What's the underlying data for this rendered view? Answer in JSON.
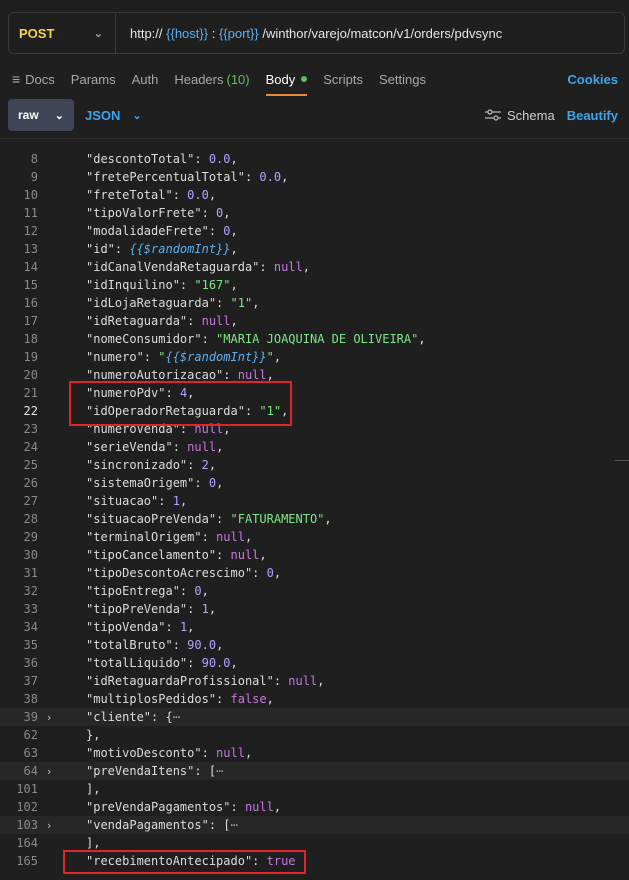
{
  "request": {
    "method": "POST",
    "url_parts": [
      {
        "text": "http:// ",
        "var": false
      },
      {
        "text": "{{host}}",
        "var": true
      },
      {
        "text": " : ",
        "var": false
      },
      {
        "text": "{{port}}",
        "var": true
      },
      {
        "text": " /winthor/varejo/matcon/v1/orders/pdvsync",
        "var": false
      }
    ]
  },
  "tabs": [
    {
      "label": "Docs",
      "icon": "docs-icon"
    },
    {
      "label": "Params"
    },
    {
      "label": "Auth"
    },
    {
      "label": "Headers",
      "count": "(10)"
    },
    {
      "label": "Body",
      "active": true
    },
    {
      "label": "Scripts"
    },
    {
      "label": "Settings"
    }
  ],
  "cookies_label": "Cookies",
  "body": {
    "mode": "raw",
    "format": "JSON",
    "schema_label": "Schema",
    "beautify_label": "Beautify"
  },
  "lines": [
    {
      "n": "8",
      "t": [
        [
          "k",
          "\"descontoTotal\""
        ],
        [
          "p",
          ": "
        ],
        [
          "n",
          "0.0"
        ],
        [
          "p",
          ","
        ]
      ]
    },
    {
      "n": "9",
      "t": [
        [
          "k",
          "\"fretePercentualTotal\""
        ],
        [
          "p",
          ": "
        ],
        [
          "n",
          "0.0"
        ],
        [
          "p",
          ","
        ]
      ]
    },
    {
      "n": "10",
      "t": [
        [
          "k",
          "\"freteTotal\""
        ],
        [
          "p",
          ": "
        ],
        [
          "n",
          "0.0"
        ],
        [
          "p",
          ","
        ]
      ]
    },
    {
      "n": "11",
      "t": [
        [
          "k",
          "\"tipoValorFrete\""
        ],
        [
          "p",
          ": "
        ],
        [
          "n",
          "0"
        ],
        [
          "p",
          ","
        ]
      ]
    },
    {
      "n": "12",
      "t": [
        [
          "k",
          "\"modalidadeFrete\""
        ],
        [
          "p",
          ": "
        ],
        [
          "n",
          "0"
        ],
        [
          "p",
          ","
        ]
      ]
    },
    {
      "n": "13",
      "t": [
        [
          "k",
          "\"id\""
        ],
        [
          "p",
          ": "
        ],
        [
          "v",
          "{{$randomInt}}"
        ],
        [
          "p",
          ","
        ]
      ]
    },
    {
      "n": "14",
      "t": [
        [
          "k",
          "\"idCanalVendaRetaguarda\""
        ],
        [
          "p",
          ": "
        ],
        [
          "kw",
          "null"
        ],
        [
          "p",
          ","
        ]
      ]
    },
    {
      "n": "15",
      "t": [
        [
          "k",
          "\"idInquilino\""
        ],
        [
          "p",
          ": "
        ],
        [
          "s",
          "\"167\""
        ],
        [
          "p",
          ","
        ]
      ]
    },
    {
      "n": "16",
      "t": [
        [
          "k",
          "\"idLojaRetaguarda\""
        ],
        [
          "p",
          ": "
        ],
        [
          "s",
          "\"1\""
        ],
        [
          "p",
          ","
        ]
      ]
    },
    {
      "n": "17",
      "t": [
        [
          "k",
          "\"idRetaguarda\""
        ],
        [
          "p",
          ": "
        ],
        [
          "kw",
          "null"
        ],
        [
          "p",
          ","
        ]
      ]
    },
    {
      "n": "18",
      "t": [
        [
          "k",
          "\"nomeConsumidor\""
        ],
        [
          "p",
          ": "
        ],
        [
          "s",
          "\"MARIA JOAQUINA DE OLIVEIRA\""
        ],
        [
          "p",
          ","
        ]
      ]
    },
    {
      "n": "19",
      "t": [
        [
          "k",
          "\"numero\""
        ],
        [
          "p",
          ": "
        ],
        [
          "s",
          "\""
        ],
        [
          "v",
          "{{$randomInt}}"
        ],
        [
          "s",
          "\""
        ],
        [
          "p",
          ","
        ]
      ]
    },
    {
      "n": "20",
      "t": [
        [
          "k",
          "\"numeroAutorizacao\""
        ],
        [
          "p",
          ": "
        ],
        [
          "kw",
          "null"
        ],
        [
          "p",
          ","
        ]
      ]
    },
    {
      "n": "21",
      "t": [
        [
          "k",
          "\"numeroPdv\""
        ],
        [
          "p",
          ": "
        ],
        [
          "n",
          "4"
        ],
        [
          "p",
          ","
        ]
      ]
    },
    {
      "n": "22",
      "cur": true,
      "t": [
        [
          "k",
          "\"idOperadorRetaguarda\""
        ],
        [
          "p",
          ": "
        ],
        [
          "s",
          "\"1\""
        ],
        [
          "p",
          ","
        ]
      ]
    },
    {
      "n": "23",
      "t": [
        [
          "k",
          "\"numeroVenda\""
        ],
        [
          "p",
          ": "
        ],
        [
          "kw",
          "null"
        ],
        [
          "p",
          ","
        ]
      ]
    },
    {
      "n": "24",
      "t": [
        [
          "k",
          "\"serieVenda\""
        ],
        [
          "p",
          ": "
        ],
        [
          "kw",
          "null"
        ],
        [
          "p",
          ","
        ]
      ]
    },
    {
      "n": "25",
      "t": [
        [
          "k",
          "\"sincronizado\""
        ],
        [
          "p",
          ": "
        ],
        [
          "n",
          "2"
        ],
        [
          "p",
          ","
        ]
      ]
    },
    {
      "n": "26",
      "t": [
        [
          "k",
          "\"sistemaOrigem\""
        ],
        [
          "p",
          ": "
        ],
        [
          "n",
          "0"
        ],
        [
          "p",
          ","
        ]
      ]
    },
    {
      "n": "27",
      "t": [
        [
          "k",
          "\"situacao\""
        ],
        [
          "p",
          ": "
        ],
        [
          "n",
          "1"
        ],
        [
          "p",
          ","
        ]
      ]
    },
    {
      "n": "28",
      "t": [
        [
          "k",
          "\"situacaoPreVenda\""
        ],
        [
          "p",
          ": "
        ],
        [
          "s",
          "\"FATURAMENTO\""
        ],
        [
          "p",
          ","
        ]
      ]
    },
    {
      "n": "29",
      "t": [
        [
          "k",
          "\"terminalOrigem\""
        ],
        [
          "p",
          ": "
        ],
        [
          "kw",
          "null"
        ],
        [
          "p",
          ","
        ]
      ]
    },
    {
      "n": "30",
      "t": [
        [
          "k",
          "\"tipoCancelamento\""
        ],
        [
          "p",
          ": "
        ],
        [
          "kw",
          "null"
        ],
        [
          "p",
          ","
        ]
      ]
    },
    {
      "n": "31",
      "t": [
        [
          "k",
          "\"tipoDescontoAcrescimo\""
        ],
        [
          "p",
          ": "
        ],
        [
          "n",
          "0"
        ],
        [
          "p",
          ","
        ]
      ]
    },
    {
      "n": "32",
      "t": [
        [
          "k",
          "\"tipoEntrega\""
        ],
        [
          "p",
          ": "
        ],
        [
          "n",
          "0"
        ],
        [
          "p",
          ","
        ]
      ]
    },
    {
      "n": "33",
      "t": [
        [
          "k",
          "\"tipoPreVenda\""
        ],
        [
          "p",
          ": "
        ],
        [
          "n",
          "1"
        ],
        [
          "p",
          ","
        ]
      ]
    },
    {
      "n": "34",
      "t": [
        [
          "k",
          "\"tipoVenda\""
        ],
        [
          "p",
          ": "
        ],
        [
          "n",
          "1"
        ],
        [
          "p",
          ","
        ]
      ]
    },
    {
      "n": "35",
      "t": [
        [
          "k",
          "\"totalBruto\""
        ],
        [
          "p",
          ": "
        ],
        [
          "n",
          "90.0"
        ],
        [
          "p",
          ","
        ]
      ]
    },
    {
      "n": "36",
      "t": [
        [
          "k",
          "\"totalLiquido\""
        ],
        [
          "p",
          ": "
        ],
        [
          "n",
          "90.0"
        ],
        [
          "p",
          ","
        ]
      ]
    },
    {
      "n": "37",
      "t": [
        [
          "k",
          "\"idRetaguardaProfissional\""
        ],
        [
          "p",
          ": "
        ],
        [
          "kw",
          "null"
        ],
        [
          "p",
          ","
        ]
      ]
    },
    {
      "n": "38",
      "t": [
        [
          "k",
          "\"multiplosPedidos\""
        ],
        [
          "p",
          ": "
        ],
        [
          "kw",
          "false"
        ],
        [
          "p",
          ","
        ]
      ]
    },
    {
      "n": "39",
      "fold": true,
      "hl": true,
      "t": [
        [
          "k",
          "\"cliente\""
        ],
        [
          "p",
          ": {"
        ],
        [
          "ell",
          "⋯"
        ]
      ]
    },
    {
      "n": "62",
      "t": [
        [
          "p",
          "},"
        ]
      ]
    },
    {
      "n": "63",
      "t": [
        [
          "k",
          "\"motivoDesconto\""
        ],
        [
          "p",
          ": "
        ],
        [
          "kw",
          "null"
        ],
        [
          "p",
          ","
        ]
      ]
    },
    {
      "n": "64",
      "fold": true,
      "hl": true,
      "t": [
        [
          "k",
          "\"preVendaItens\""
        ],
        [
          "p",
          ": ["
        ],
        [
          "ell",
          "⋯"
        ]
      ]
    },
    {
      "n": "101",
      "t": [
        [
          "p",
          "],"
        ]
      ]
    },
    {
      "n": "102",
      "t": [
        [
          "k",
          "\"preVendaPagamentos\""
        ],
        [
          "p",
          ": "
        ],
        [
          "kw",
          "null"
        ],
        [
          "p",
          ","
        ]
      ]
    },
    {
      "n": "103",
      "fold": true,
      "hl": true,
      "t": [
        [
          "k",
          "\"vendaPagamentos\""
        ],
        [
          "p",
          ": ["
        ],
        [
          "ell",
          "⋯"
        ]
      ]
    },
    {
      "n": "164",
      "t": [
        [
          "p",
          "],"
        ]
      ]
    },
    {
      "n": "165",
      "t": [
        [
          "k",
          "\"recebimentoAntecipado\""
        ],
        [
          "p",
          ": "
        ],
        [
          "kw",
          "true"
        ]
      ]
    }
  ]
}
